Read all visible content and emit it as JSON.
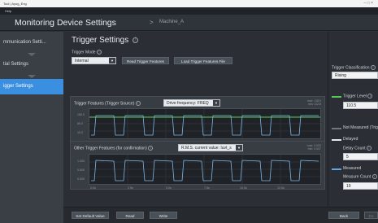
{
  "window": {
    "title": "Tool | Ayog_Eng",
    "controls": "–  □  ×"
  },
  "menu": {
    "help": "Help"
  },
  "header": {
    "title": "Monitoring Device Settings",
    "crumb_sep": ">",
    "crumb": "Machine_A"
  },
  "sidebar": {
    "items": [
      {
        "label": "mmunication Setti..."
      },
      {
        "label": "tial Settings"
      },
      {
        "label": "igger Settings"
      }
    ]
  },
  "page": {
    "title": "Trigger Settings",
    "info": "ⓘ",
    "trigger_mode_label": "Trigger Mode",
    "trigger_mode_value": "Internal",
    "read_features_button": "Read Trigger Features",
    "load_features_button": "Load Trigger Features File"
  },
  "panel1": {
    "title": "Trigger Features (Trigger Source)",
    "select_value": "Drive frequency: FREQ",
    "max": "max: 118.0",
    "min": "min: 112.8",
    "yticks": [
      "150.0",
      "80.0",
      "10.0"
    ],
    "xticks": [
      "0.0s",
      "2.5s",
      "5.0s",
      "7.5s",
      "10.0s",
      "12.5s"
    ]
  },
  "panel2": {
    "title": "Other Trigger Features (for confirmation)",
    "select_value": "R.M.S. current value: Iuvt_s",
    "max": "max: 0.003",
    "min": "min: 0.007",
    "yticks": [
      "1.000",
      "0.500",
      "0.000"
    ],
    "xticks": [
      "0.0s",
      "2.5s",
      "5.0s",
      "7.5s",
      "10.0s",
      "12.5s"
    ]
  },
  "right": {
    "classification_label": "Trigger Classification",
    "classification_value": "Rising",
    "trigger_level_label": "Trigger Level",
    "trigger_level_value": "110.5",
    "not_measured_label": "Not Measured (Trig",
    "delayed_label": "Delayed",
    "delay_count_label": "Delay Count",
    "delay_count_value": "5",
    "measured_label": "Measured",
    "measure_count_label": "Measure Count",
    "measure_count_value": "19"
  },
  "footer": {
    "set_default": "Set Default Value",
    "read": "Read",
    "write": "Write",
    "back": "Back",
    "next": "Co"
  },
  "colors": {
    "accent": "#3a8fe0",
    "trigger_level": "#58c85a",
    "signal": "#7fb6e6",
    "delayed": "#e8e8e8",
    "measured": "#5fa8e8",
    "not_measured": "#777777"
  }
}
